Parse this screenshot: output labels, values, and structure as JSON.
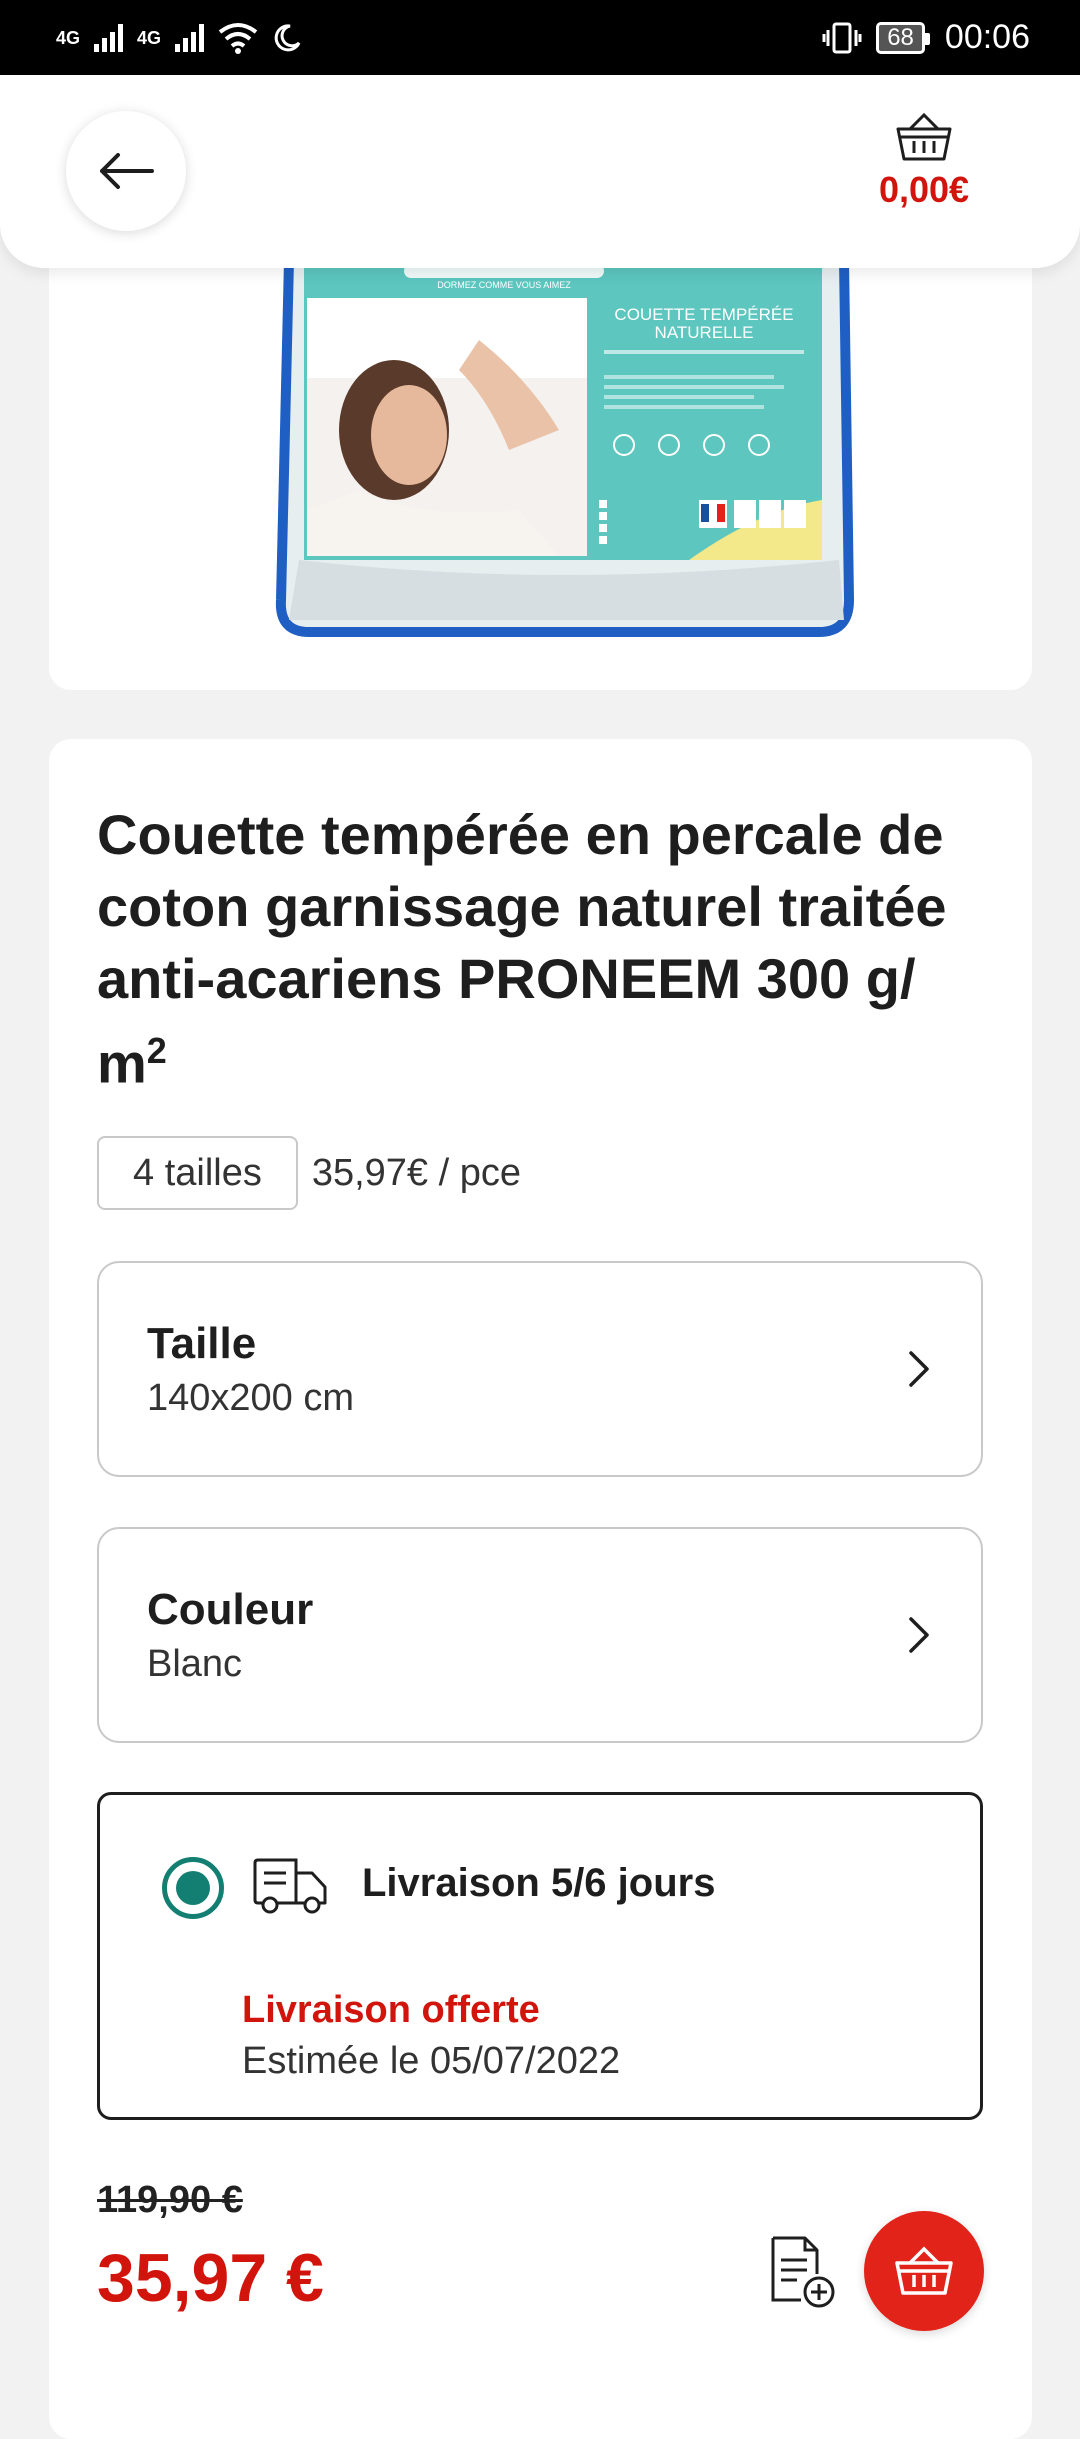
{
  "status_bar": {
    "network_1": "4G",
    "network_2": "4G",
    "battery": "68",
    "time": "00:06"
  },
  "header": {
    "cart_total": "0,00€",
    "icons": {
      "back": "arrow-left-icon",
      "cart": "basket-icon"
    }
  },
  "product_image": {
    "alt": "Couette tempérée naturelle packaging",
    "package_top_text": "DORMEZ COMME VOUS AIMEZ",
    "package_title_line1": "COUETTE TEMPÉRÉE",
    "package_title_line2": "NATURELLE"
  },
  "product": {
    "title": "Couette tempérée en percale de coton garnissage naturel traitée anti-acariens PRONEEM 300 g/",
    "title_unit_base": "m",
    "title_unit_exp": "2",
    "sizes_badge": "4 tailles",
    "unit_price": "35,97€ / pce"
  },
  "options": {
    "size": {
      "label": "Taille",
      "value": "140x200 cm"
    },
    "color": {
      "label": "Couleur",
      "value": "Blanc"
    }
  },
  "delivery": {
    "title": "Livraison 5/6 jours",
    "free_label": "Livraison offerte",
    "estimate": "Estimée le 05/07/2022",
    "selected": true
  },
  "pricing": {
    "old_price": "119,90 €",
    "price": "35,97 €"
  },
  "colors": {
    "accent_red": "#d1150c",
    "button_red": "#e2231a",
    "radio_teal": "#137f72",
    "package_teal": "#5cc6bf",
    "package_border": "#1f5fc4"
  }
}
